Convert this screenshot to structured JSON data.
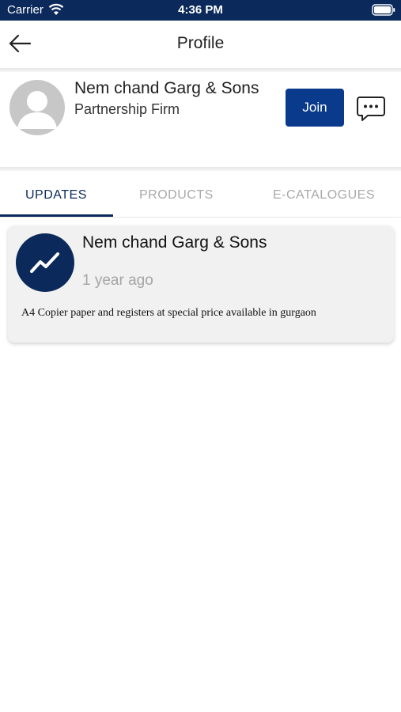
{
  "status_bar": {
    "carrier": "Carrier",
    "time": "4:36 PM",
    "icons": [
      "wifi-icon",
      "battery-icon"
    ]
  },
  "header": {
    "title": "Profile",
    "back_icon": "arrow-left-icon"
  },
  "profile": {
    "name": "Nem chand Garg & Sons",
    "type": "Partnership Firm",
    "join_label": "Join",
    "avatar_icon": "person-icon",
    "chat_icon": "chat-bubble-icon"
  },
  "tabs": [
    {
      "label": "UPDATES",
      "active": true
    },
    {
      "label": "PRODUCTS",
      "active": false
    },
    {
      "label": "E-CATALOGUES",
      "active": false
    }
  ],
  "updates": [
    {
      "author": "Nem chand Garg & Sons",
      "time_ago": "1 year ago",
      "content": "A4 Copier paper and registers at special price available in gurgaon",
      "avatar_icon": "trending-up-icon"
    }
  ],
  "colors": {
    "primary": "#0b2a5b",
    "button": "#0a3a8c",
    "inactive_tab": "#a9a9a9",
    "card_bg": "#f1f1f1"
  }
}
